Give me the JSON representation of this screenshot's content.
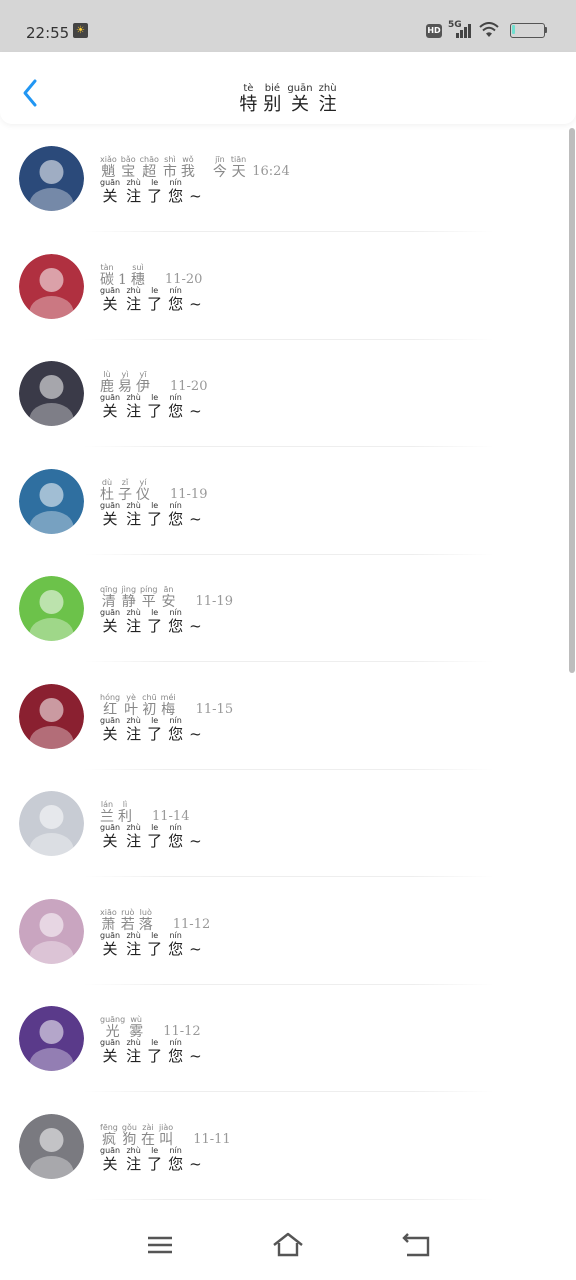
{
  "status_bar": {
    "time": "22:55",
    "app_icon": "weather-app-icon",
    "hd": "HD",
    "network": "5G",
    "battery_level": 0.1,
    "battery_color": "#6fe0d0"
  },
  "header": {
    "back_icon": "chevron-left-icon",
    "back_color": "#2196F3",
    "title": [
      {
        "py": "tè",
        "han": "特"
      },
      {
        "py": "bié",
        "han": "别"
      },
      {
        "py": "guān",
        "han": "关"
      },
      {
        "py": "zhù",
        "han": "注"
      }
    ]
  },
  "follows": [
    {
      "name": [
        {
          "py": "xiǎo",
          "han": "魈"
        },
        {
          "py": "bǎo",
          "han": "宝"
        },
        {
          "py": "chāo",
          "han": "超"
        },
        {
          "py": "shì",
          "han": "市"
        },
        {
          "py": "wǒ",
          "han": "我"
        }
      ],
      "time_py": [
        {
          "py": "jīn",
          "han": "今"
        },
        {
          "py": "tiān",
          "han": "天"
        }
      ],
      "time": "16:24"
    },
    {
      "name": [
        {
          "py": "tàn",
          "han": "碳"
        },
        {
          "py": "",
          "han": "1"
        },
        {
          "py": "suì",
          "han": "穗"
        }
      ],
      "time": "11-20"
    },
    {
      "name": [
        {
          "py": "lù",
          "han": "鹿"
        },
        {
          "py": "yì",
          "han": "易"
        },
        {
          "py": "yī",
          "han": "伊"
        }
      ],
      "time": "11-20"
    },
    {
      "name": [
        {
          "py": "dù",
          "han": "杜"
        },
        {
          "py": "zǐ",
          "han": "子"
        },
        {
          "py": "yí",
          "han": "仪"
        }
      ],
      "time": "11-19"
    },
    {
      "name": [
        {
          "py": "qīng",
          "han": "清"
        },
        {
          "py": "jìng",
          "han": "静"
        },
        {
          "py": "píng",
          "han": "平"
        },
        {
          "py": "ān",
          "han": "安"
        }
      ],
      "time": "11-19"
    },
    {
      "name": [
        {
          "py": "hóng",
          "han": "红"
        },
        {
          "py": "yè",
          "han": "叶"
        },
        {
          "py": "chū",
          "han": "初"
        },
        {
          "py": "méi",
          "han": "梅"
        }
      ],
      "time": "11-15"
    },
    {
      "name": [
        {
          "py": "lán",
          "han": "兰"
        },
        {
          "py": "lì",
          "han": "利"
        }
      ],
      "time": "11-14"
    },
    {
      "name": [
        {
          "py": "xiāo",
          "han": "萧"
        },
        {
          "py": "ruò",
          "han": "若"
        },
        {
          "py": "luò",
          "han": "落"
        }
      ],
      "time": "11-12"
    },
    {
      "name": [
        {
          "py": "guāng",
          "han": "光"
        },
        {
          "py": "wù",
          "han": "雾"
        }
      ],
      "time": "11-12"
    },
    {
      "name": [
        {
          "py": "fēng",
          "han": "疯"
        },
        {
          "py": "gǒu",
          "han": "狗"
        },
        {
          "py": "zài",
          "han": "在"
        },
        {
          "py": "jiào",
          "han": "叫"
        }
      ],
      "time": "11-11"
    }
  ],
  "follow_message": [
    {
      "py": "guān",
      "han": "关"
    },
    {
      "py": "zhù",
      "han": "注"
    },
    {
      "py": "le",
      "han": "了"
    },
    {
      "py": "nín",
      "han": "您"
    }
  ],
  "follow_message_suffix": "~",
  "avatars": [
    "#2b4a7a",
    "#b03040",
    "#3a3a48",
    "#2f6fa0",
    "#6cc24a",
    "#8a2030",
    "#c8ccd4",
    "#c9a5c0",
    "#5a3a8a",
    "#7a7a80"
  ],
  "nav": {
    "menu_icon": "menu-icon",
    "home_icon": "home-icon",
    "back_icon": "return-icon"
  }
}
